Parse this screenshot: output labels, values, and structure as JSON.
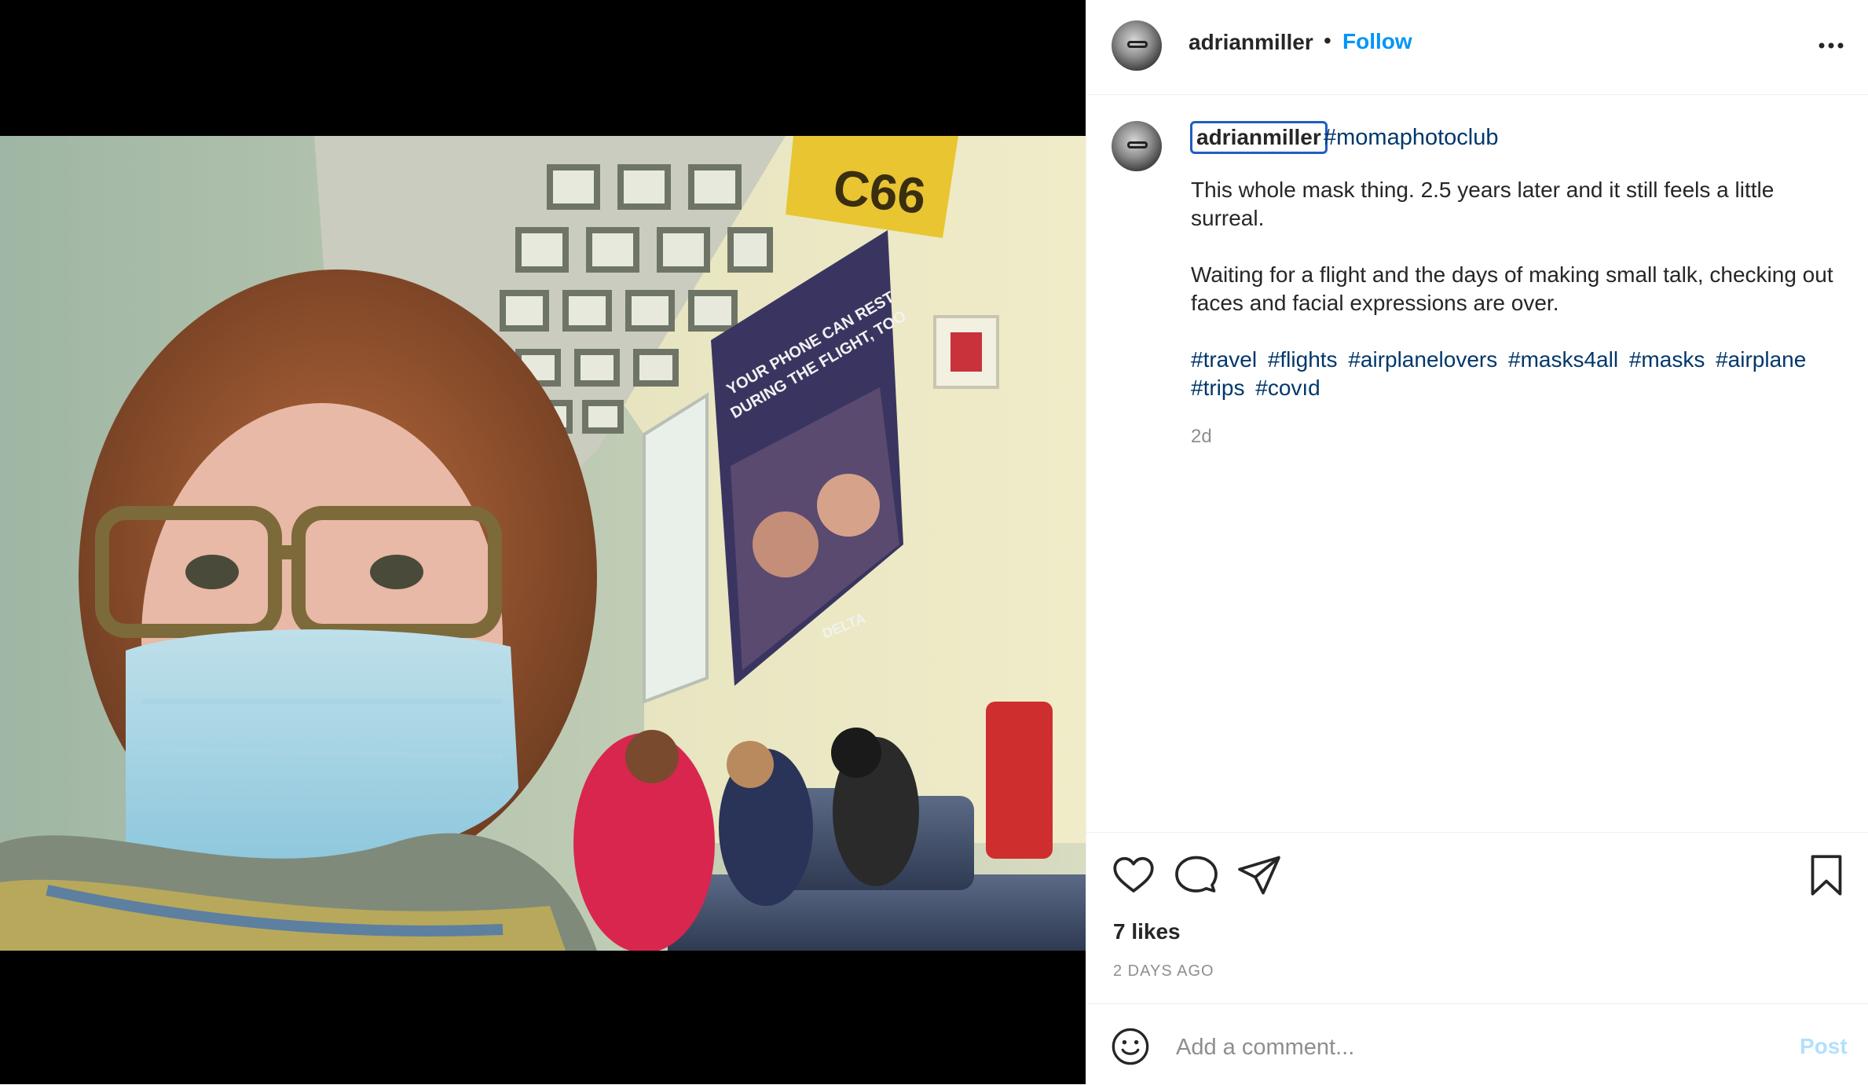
{
  "post": {
    "username": "adrianmiller",
    "follow_label": "Follow",
    "header_dot": "•",
    "more_icon": "more-horizontal-icon"
  },
  "caption": {
    "username": "adrianmiller",
    "first_tag": "#momaphotoclub",
    "paragraph1": "This whole mask thing. 2.5 years later and it still feels a little surreal.",
    "paragraph2": "Waiting for a flight and the days of making small talk, checking out faces and facial expressions are over.",
    "hashtags": [
      "#travel",
      "#flights",
      "#airplanelovers",
      "#masks4all",
      "#masks",
      "#airplane",
      "#trips",
      "#covıd"
    ],
    "time_ago": "2d"
  },
  "photo": {
    "gate_sign": "C66",
    "poster_line1": "YOUR PHONE CAN REST",
    "poster_line2": "DURING THE FLIGHT, TOO",
    "poster_brand": "DELTA"
  },
  "actions": {
    "like_icon": "heart-icon",
    "comment_icon": "comment-icon",
    "share_icon": "send-icon",
    "save_icon": "bookmark-icon",
    "likes": "7 likes",
    "date": "2 DAYS AGO"
  },
  "comment_box": {
    "placeholder": "Add a comment...",
    "post_label": "Post",
    "emoji_icon": "smiley-icon"
  },
  "colors": {
    "link_blue": "#0095f6",
    "hashtag_blue": "#00376b",
    "post_disabled": "#b2dffc",
    "muted": "#8e8e8e"
  }
}
